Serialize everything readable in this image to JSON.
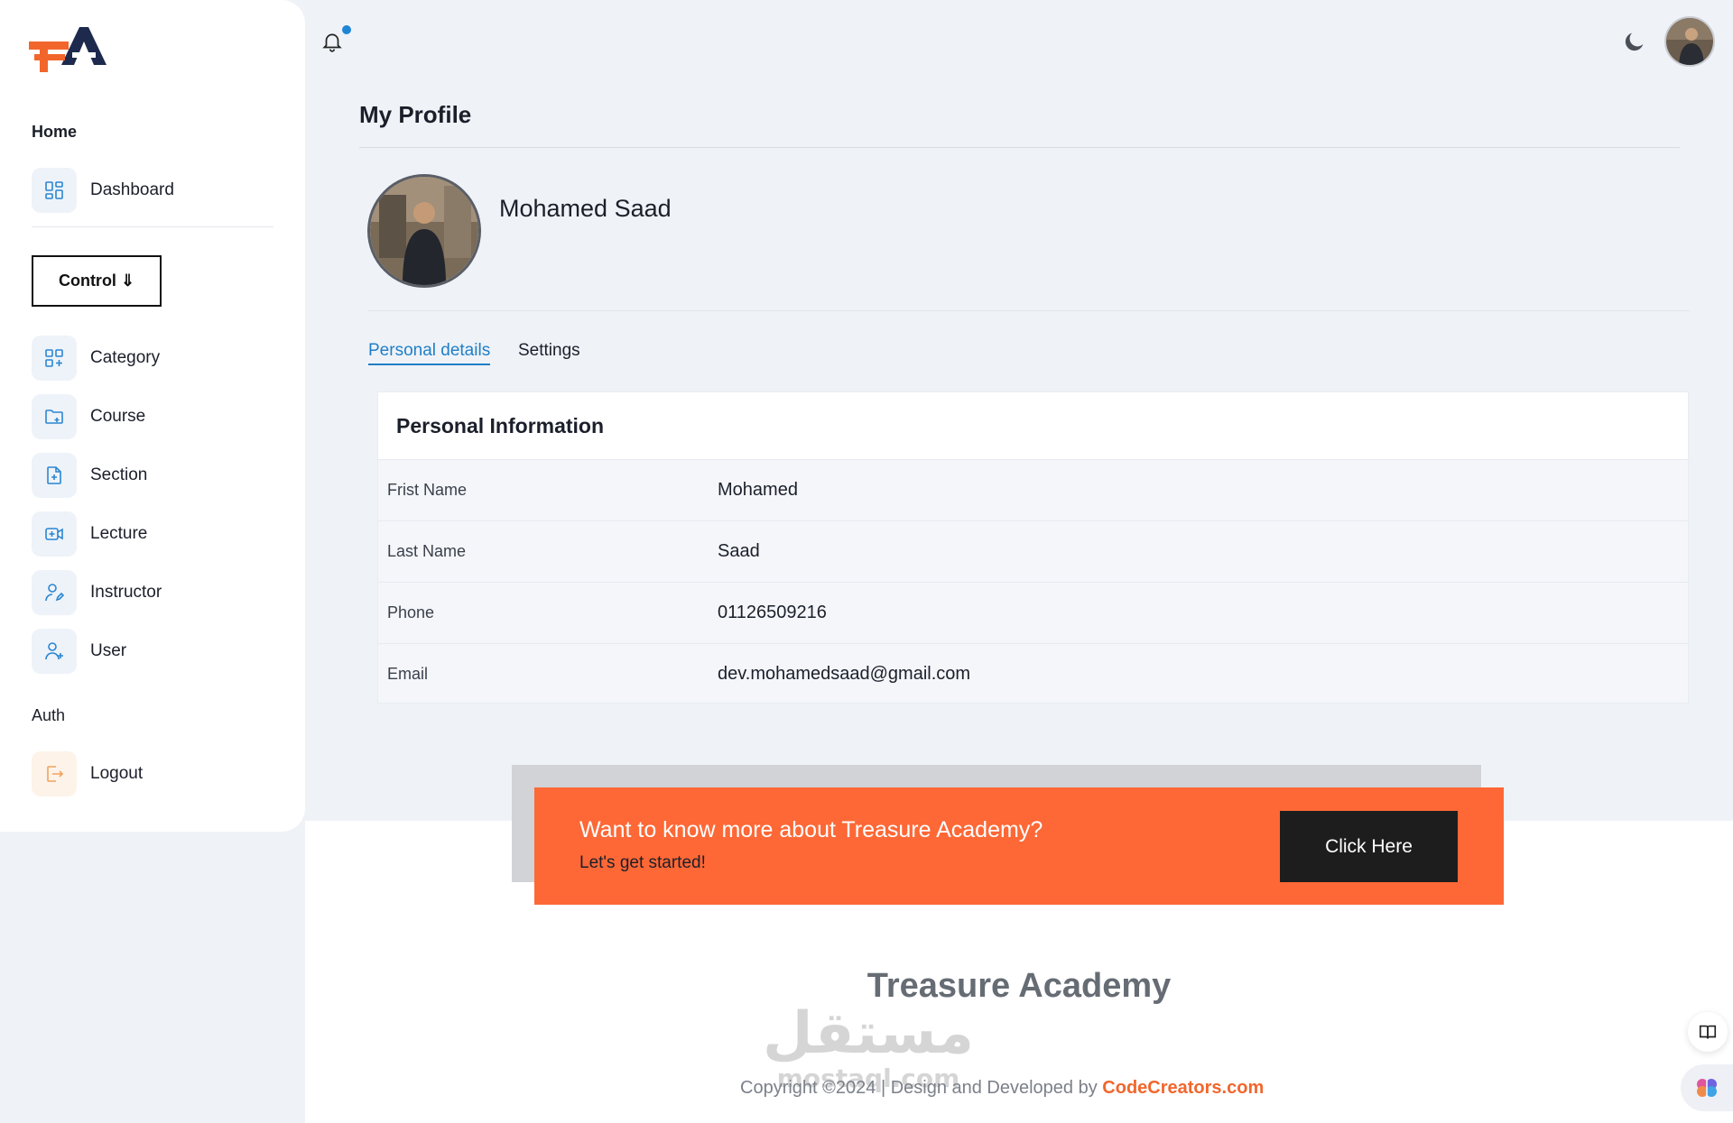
{
  "sidebar": {
    "home_heading": "Home",
    "dashboard_label": "Dashboard",
    "control_button": "Control ⇓",
    "items": [
      {
        "label": "Category",
        "icon": "category-icon"
      },
      {
        "label": "Course",
        "icon": "folder-add-icon"
      },
      {
        "label": "Section",
        "icon": "document-add-icon"
      },
      {
        "label": "Lecture",
        "icon": "video-add-icon"
      },
      {
        "label": "Instructor",
        "icon": "user-edit-icon"
      },
      {
        "label": "User",
        "icon": "user-add-icon"
      }
    ],
    "auth_heading": "Auth",
    "logout_label": "Logout"
  },
  "main": {
    "page_title": "My Profile",
    "profile_name": "Mohamed Saad",
    "tabs": [
      {
        "label": "Personal details",
        "active": true
      },
      {
        "label": "Settings",
        "active": false
      }
    ],
    "info": {
      "heading": "Personal Information",
      "rows": [
        {
          "label": "Frist Name",
          "value": "Mohamed"
        },
        {
          "label": "Last Name",
          "value": "Saad"
        },
        {
          "label": "Phone",
          "value": "01126509216"
        },
        {
          "label": "Email",
          "value": "dev.mohamedsaad@gmail.com"
        }
      ]
    }
  },
  "banner": {
    "title": "Want to know more about Treasure Academy?",
    "subtitle": "Let's get started!",
    "button": "Click Here"
  },
  "footer": {
    "brand": "Treasure Academy",
    "copyright_text": "Copyright ©2024 | Design and Developed by ",
    "copyright_brand": "CodeCreators.com",
    "watermark_text": "مستقل",
    "watermark_sub": "mostaql.com"
  },
  "colors": {
    "accent_blue": "#1f7fc7",
    "banner_orange": "#fd6836",
    "brand_orange": "#f2662c",
    "logo_navy": "#1d2a4d"
  }
}
